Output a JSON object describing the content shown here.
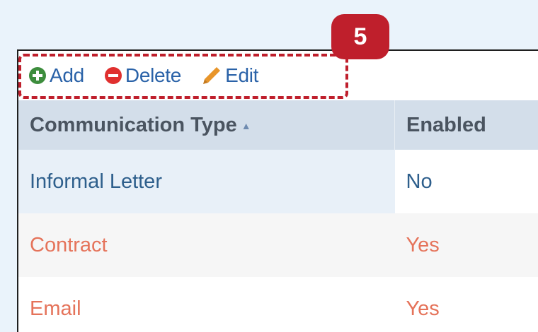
{
  "toolbar": {
    "add_label": "Add",
    "delete_label": "Delete",
    "edit_label": "Edit",
    "add_icon": "plus-circle-icon",
    "delete_icon": "minus-circle-icon",
    "edit_icon": "pencil-icon"
  },
  "callout": {
    "number": "5",
    "color": "#bf1f2c"
  },
  "table": {
    "columns": [
      {
        "label": "Communication Type",
        "sort": "ascending"
      },
      {
        "label": "Enabled"
      }
    ],
    "rows": [
      {
        "type": "Informal Letter",
        "enabled": "No"
      },
      {
        "type": "Contract",
        "enabled": "Yes"
      },
      {
        "type": "Email",
        "enabled": "Yes"
      }
    ]
  },
  "colors": {
    "link_blue": "#2a62a8",
    "add_green": "#3d8d3d",
    "delete_red": "#e0302f",
    "edit_orange": "#e8952a",
    "row_highlight_text": "#e5735a"
  }
}
